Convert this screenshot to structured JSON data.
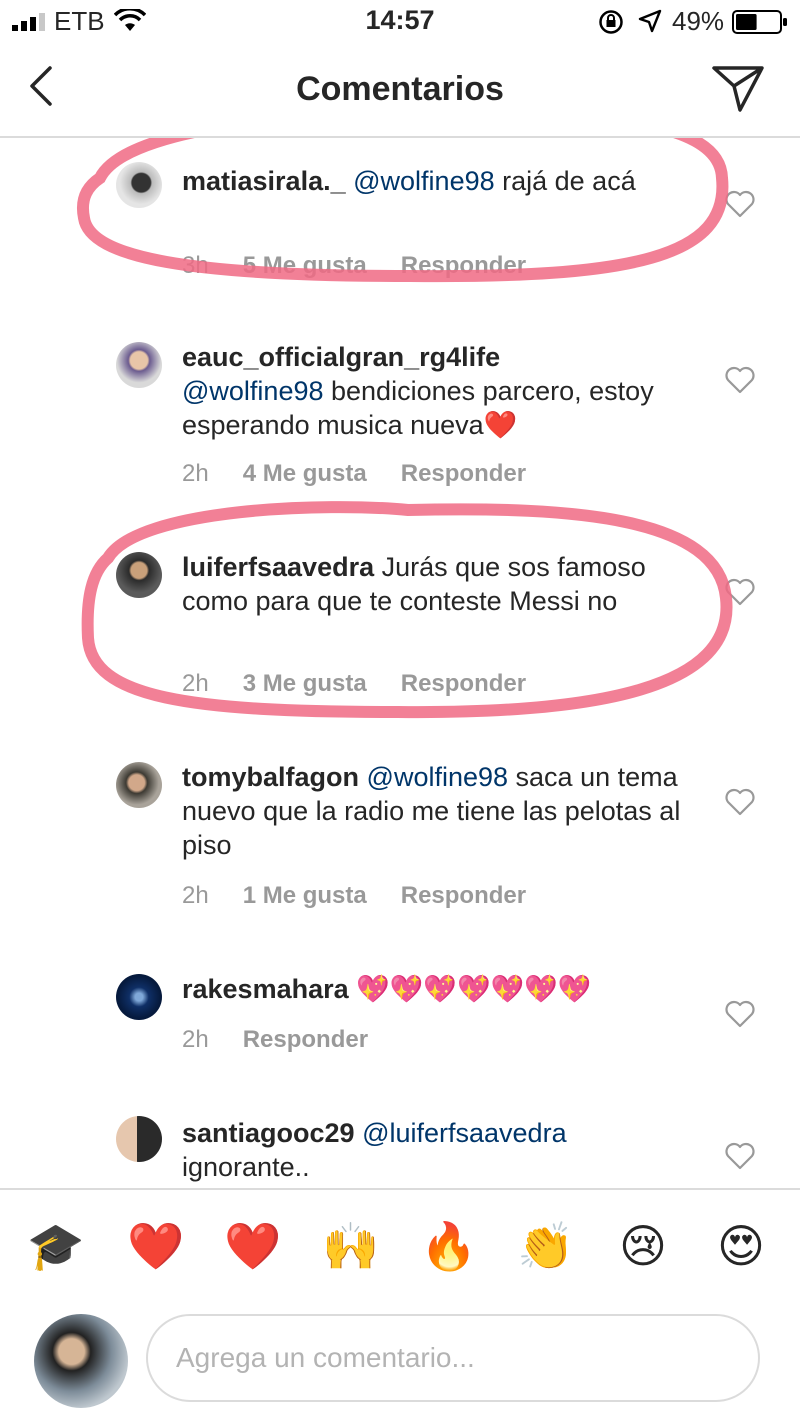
{
  "status_bar": {
    "carrier": "ETB",
    "time": "14:57",
    "battery": "49%",
    "battery_level": 0.49
  },
  "header": {
    "title": "Comentarios",
    "back_icon": "chevron-left-icon",
    "share_icon": "paper-plane-icon"
  },
  "comments": [
    {
      "user": "matiasirala._",
      "mention": "@wolfine98",
      "text": " rajá de acá",
      "time": "3h",
      "likes": "5 Me gusta",
      "reply": "Responder",
      "highlighted": true
    },
    {
      "user": "eauc_officialgran_rg4life",
      "mention": "@wolfine98",
      "text": " bendiciones parcero, estoy esperando musica nueva❤️",
      "time": "2h",
      "likes": "4 Me gusta",
      "reply": "Responder",
      "highlighted": false
    },
    {
      "user": "luiferfsaavedra",
      "mention": "",
      "text": " Jurás que sos famoso como para que te conteste Messi no",
      "time": "2h",
      "likes": "3 Me gusta",
      "reply": "Responder",
      "highlighted": true
    },
    {
      "user": "tomybalfagon",
      "mention": "@wolfine98",
      "text": " saca un tema nuevo que la radio me tiene las pelotas al piso",
      "time": "2h",
      "likes": "1 Me gusta",
      "reply": "Responder",
      "highlighted": false
    },
    {
      "user": "rakesmahara",
      "mention": "",
      "text": " 💖💖💖💖💖💖💖",
      "time": "2h",
      "likes": "",
      "reply": "Responder",
      "highlighted": false
    },
    {
      "user": "santiagooc29",
      "mention": "@luiferfsaavedra",
      "text": " ignorante..",
      "time": "",
      "likes": "",
      "reply": "",
      "highlighted": false
    }
  ],
  "reactions": [
    "🎓",
    "❤️",
    "❤️",
    "🙌",
    "🔥",
    "👏",
    "😢",
    "😍"
  ],
  "composer": {
    "placeholder": "Agrega un comentario..."
  },
  "colors": {
    "mention": "#003569",
    "meta": "#999999",
    "highlight": "#f06a84",
    "divider": "#dbdbdb"
  }
}
